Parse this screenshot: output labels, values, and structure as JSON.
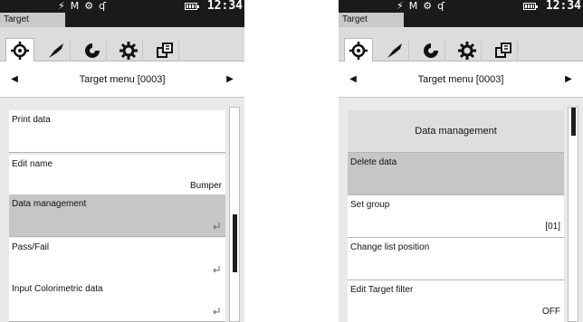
{
  "left": {
    "window_title": "Target",
    "clock": "12:34",
    "nav_title": "Target menu [0003]",
    "scroll": {
      "thumb_start": 0.5,
      "thumb_end": 0.77
    },
    "items": [
      {
        "label": "Print data",
        "value": "",
        "enter": false,
        "state": "normal"
      },
      {
        "label": "Edit name",
        "value": "Bumper",
        "enter": false,
        "state": "normal"
      },
      {
        "label": "Data management",
        "value": "",
        "enter": true,
        "state": "selected"
      },
      {
        "label": "Pass/Fail",
        "value": "",
        "enter": true,
        "state": "normal"
      },
      {
        "label": "Input Colorimetric data",
        "value": "",
        "enter": true,
        "state": "normal"
      }
    ]
  },
  "right": {
    "window_title": "Target",
    "clock": "12:34",
    "nav_title": "Target menu [0003]",
    "scroll": {
      "thumb_start": 0.0,
      "thumb_end": 0.13
    },
    "items": [
      {
        "label": "Data management",
        "value": "",
        "enter": false,
        "state": "header"
      },
      {
        "label": "Delete data",
        "value": "",
        "enter": false,
        "state": "selected"
      },
      {
        "label": "Set group",
        "value": "[01]",
        "enter": false,
        "state": "normal"
      },
      {
        "label": "Change list position",
        "value": "",
        "enter": false,
        "state": "normal"
      },
      {
        "label": "Edit Target filter",
        "value": "OFF",
        "enter": false,
        "state": "normal"
      }
    ]
  },
  "status_icons": [
    "lightning-icon",
    "mode-icon",
    "bluetooth-icon",
    "battery-icon"
  ],
  "tabs": [
    "target-tab-icon",
    "measure-tab-icon",
    "color-tab-icon",
    "settings-tab-icon",
    "multi-window-icon"
  ],
  "nav": {
    "prev_icon": "arrow-left-icon",
    "next_icon": "arrow-right-icon"
  },
  "colors": {
    "status_bar": "#1a1a1a",
    "selected_row": "#c6c6c6",
    "header_row": "#dedede",
    "tab_bar": "#dcdcdc"
  }
}
